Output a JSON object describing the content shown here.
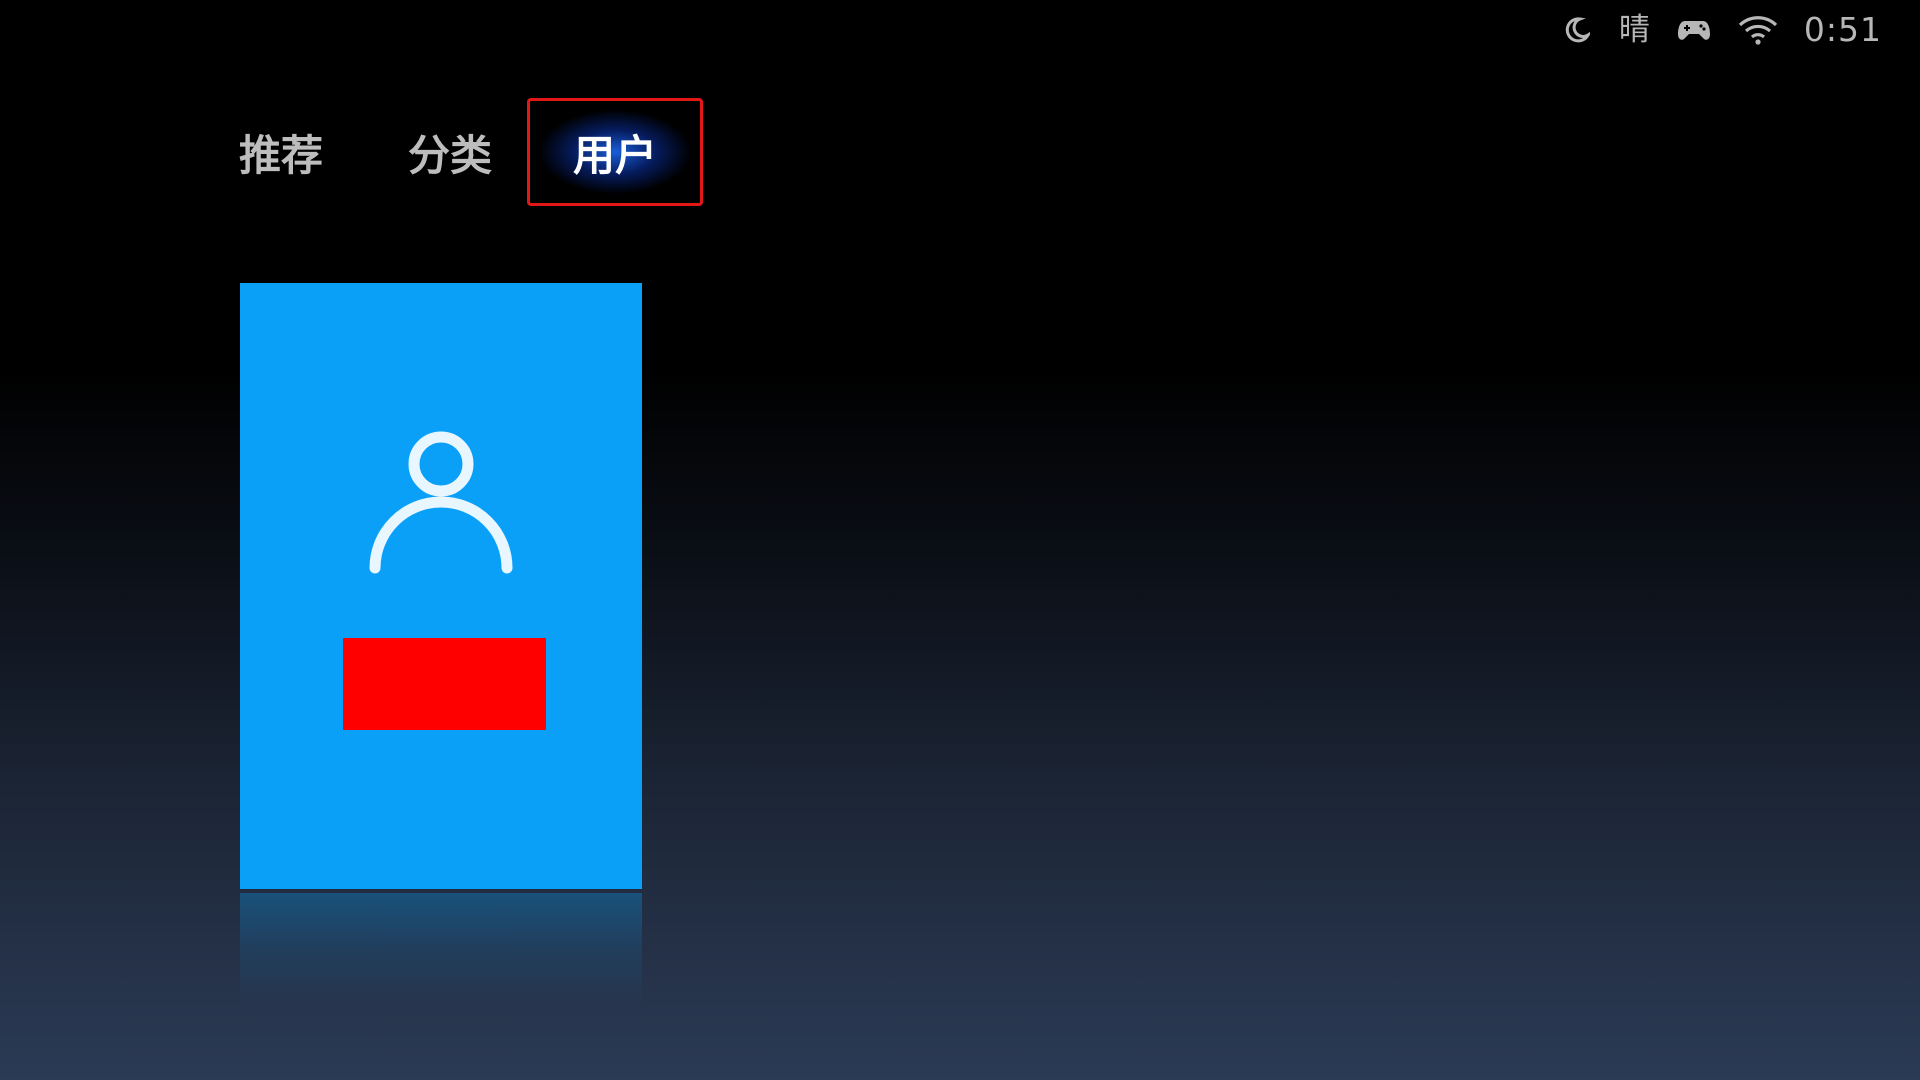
{
  "status_bar": {
    "night_icon": "moon-icon",
    "weather": "晴",
    "gamepad_icon": "gamepad-icon",
    "wifi_icon": "wifi-icon",
    "time": "0:51"
  },
  "tabs": [
    {
      "label": "推荐",
      "selected": false
    },
    {
      "label": "分类",
      "selected": false
    },
    {
      "label": "用户",
      "selected": true
    }
  ],
  "user_tile": {
    "icon": "user-avatar-icon",
    "background_color": "#0aa0f8",
    "name_redaction_color": "#ff0000"
  },
  "colors": {
    "highlight_border": "#e01818",
    "tab_text": "#bdbdbd",
    "tab_text_selected": "#ffffff"
  }
}
